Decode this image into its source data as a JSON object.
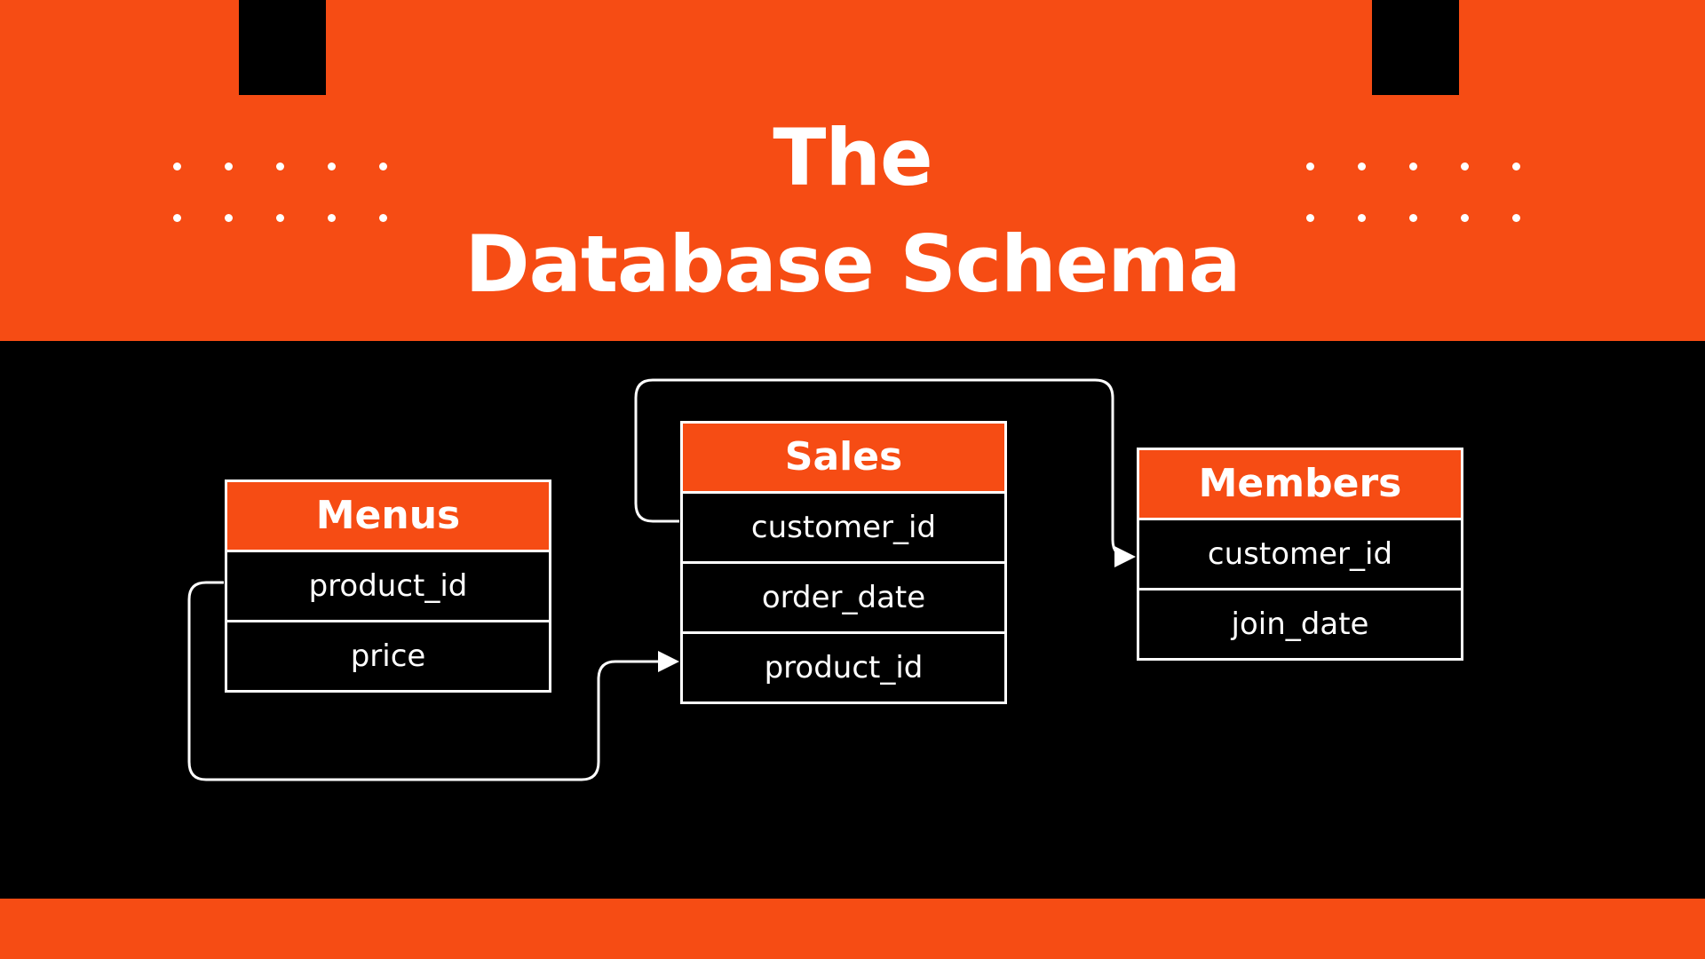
{
  "title": {
    "line1": "The",
    "line2": "Database Schema"
  },
  "colors": {
    "accent": "#F64C14",
    "background": "#000000",
    "text": "#FFFFFF"
  },
  "tables": {
    "menus": {
      "name": "Menus",
      "fields": [
        "product_id",
        "price"
      ]
    },
    "sales": {
      "name": "Sales",
      "fields": [
        "customer_id",
        "order_date",
        "product_id"
      ]
    },
    "members": {
      "name": "Members",
      "fields": [
        "customer_id",
        "join_date"
      ]
    }
  },
  "relationships": [
    {
      "from": "menus.product_id",
      "to": "sales.product_id"
    },
    {
      "from": "sales.customer_id",
      "to": "members.customer_id"
    }
  ]
}
